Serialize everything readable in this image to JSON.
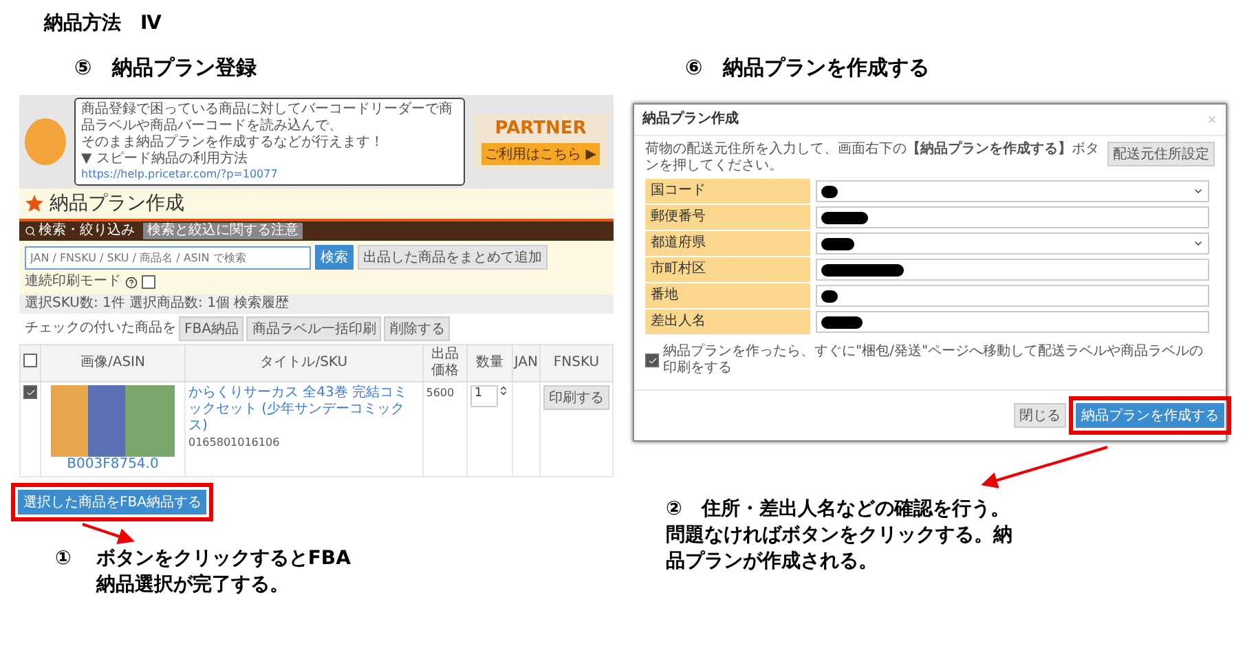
{
  "title": "納品方法　Ⅳ",
  "left_panel": {
    "heading": "⑤　納品プラン登録",
    "screenshot": {
      "banner": {
        "lines": [
          "商品登録で困っている商品に対してバーコードリーダーで商品ラベルや商品バーコードを読み込んで、",
          "そのまま納品プランを作成するなどが行えます！",
          "▼ スピード納品の利用方法"
        ],
        "link": "https://help.pricetar.com/?p=10077",
        "ad_title": "PARTNER",
        "ad_button": "ご利用はこちら ▶"
      },
      "page_title": "納品プラン作成",
      "search_bar": {
        "label": "検索・絞り込み",
        "notice": "検索と絞込に関する注意",
        "placeholder": "JAN / FNSKU / SKU / 商品名 / ASIN で検索",
        "search_button": "検索",
        "add_button": "出品した商品をまとめて追加",
        "mode_label": "連続印刷モード",
        "mode_checked": false
      },
      "summary": "選択SKU数: 1件 選択商品数: 1個 検索履歴",
      "bulk": {
        "label": "チェックの付いた商品を",
        "buttons": [
          "FBA納品",
          "商品ラベル一括印刷",
          "削除する"
        ]
      },
      "table": {
        "header_checked": false,
        "columns": [
          "画像/ASIN",
          "タイトル/SKU",
          "出品価格",
          "数量",
          "JAN",
          "FNSKU"
        ],
        "rows": [
          {
            "checked": true,
            "asin": "B003F8754.0",
            "title": "からくりサーカス 全43巻 完結コミックセット (少年サンデーコミックス)",
            "sku": "0165801016106",
            "price": "5600",
            "quantity": "1",
            "print_button": "印刷する"
          }
        ]
      },
      "submit_button": "選択した商品をFBA納品する"
    },
    "caption": {
      "number": "①",
      "lines": [
        "ボタンをクリックするとFBA",
        "納品選択が完了する。"
      ]
    }
  },
  "right_panel": {
    "heading": "⑥　納品プランを作成する",
    "dialog": {
      "title": "納品プラン作成",
      "description": "荷物の配送元住所を入力して、画面右下の**【納品プランを作成する】**ボタンを押してください。",
      "address_button": "配送元住所設定",
      "fields": [
        {
          "label": "国コード",
          "kind": "select",
          "redacted": true
        },
        {
          "label": "郵便番号",
          "kind": "text",
          "redacted": true
        },
        {
          "label": "都道府県",
          "kind": "select",
          "redacted": true
        },
        {
          "label": "市町村区",
          "kind": "text",
          "redacted": true
        },
        {
          "label": "番地",
          "kind": "text",
          "redacted": true
        },
        {
          "label": "差出人名",
          "kind": "text",
          "redacted": true
        }
      ],
      "option_checked": true,
      "option_label": "納品プランを作ったら、すぐに\"梱包/発送\"ページへ移動して配送ラベルや商品ラベルの印刷をする",
      "close_button": "閉じる",
      "submit_button": "納品プランを作成する"
    },
    "caption": {
      "lines": [
        "②　住所・差出人名などの確認を行う。",
        "問題なければボタンをクリックする。納品プランが作成される。"
      ]
    }
  }
}
